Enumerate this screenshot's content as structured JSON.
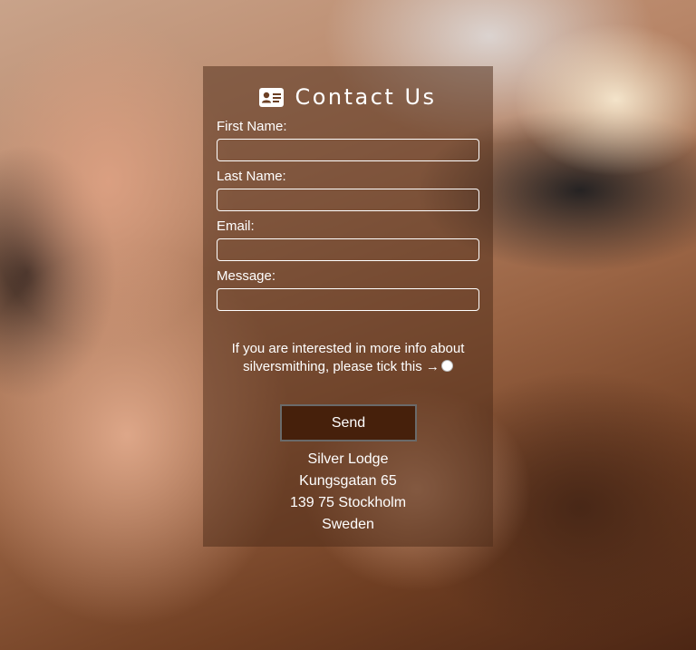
{
  "background": {
    "icon": "silversmith-workshop-photo"
  },
  "form": {
    "title": "Contact Us",
    "title_icon": "id-card-icon",
    "fields": [
      {
        "label": "First Name:",
        "value": "",
        "placeholder": ""
      },
      {
        "label": "Last Name:",
        "value": "",
        "placeholder": ""
      },
      {
        "label": "Email:",
        "value": "",
        "placeholder": ""
      },
      {
        "label": "Message:",
        "value": "",
        "placeholder": ""
      }
    ],
    "interest_text": "If you are interested in more info about silversmithing, please tick this →",
    "interest_checked": false,
    "send_label": "Send"
  },
  "address": {
    "name": "Silver Lodge",
    "street": "Kungsgatan 65",
    "city": "139 75 Stockholm",
    "country": "Sweden"
  },
  "colors": {
    "card_overlay": "#4e2c18",
    "button_bg": "#46200b",
    "text": "#ffffff"
  }
}
